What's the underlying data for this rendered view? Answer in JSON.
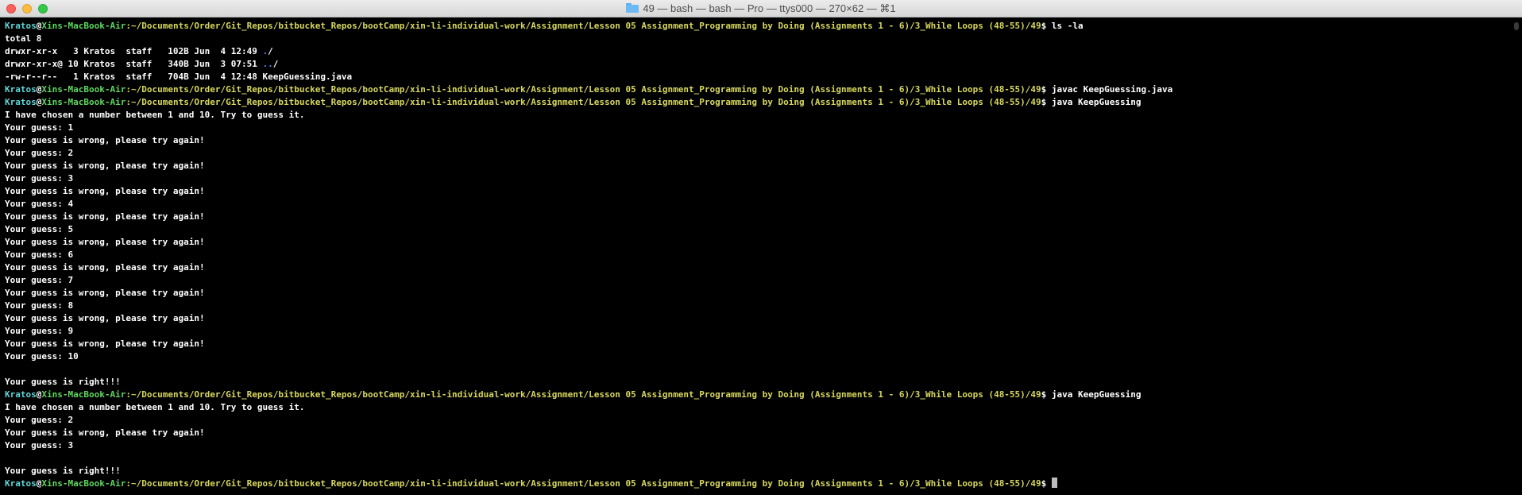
{
  "window": {
    "title": "49 — bash — bash — Pro — ttys000 — 270×62 — ⌘1",
    "folder_icon": "folder-icon"
  },
  "prompt": {
    "user": "Kratos",
    "at": "@",
    "host": "Xins-MacBook-Air",
    "path": ":~/Documents/Order/Git_Repos/bitbucket_Repos/bootCamp/xin-li-individual-work/Assignment/Lesson 05 Assignment_Programming by Doing (Assignments 1 - 6)/3_While Loops (48-55)/49",
    "dollar": "$ "
  },
  "colors": {
    "background": "#000000",
    "user": "#5fd7d7",
    "host": "#5fd75f",
    "path": "#d7d75f",
    "directory": "#5f87ff",
    "text": "#ffffff"
  },
  "lines": [
    {
      "type": "prompt",
      "cmd": "ls -la"
    },
    {
      "type": "out",
      "text": "total 8"
    },
    {
      "type": "ls",
      "pre": "drwxr-xr-x   3 Kratos  staff   102B Jun  4 12:49 ",
      "dir": ".",
      "post": "/"
    },
    {
      "type": "ls",
      "pre": "drwxr-xr-x@ 10 Kratos  staff   340B Jun  3 07:51 ",
      "dir": "..",
      "post": "/"
    },
    {
      "type": "out",
      "text": "-rw-r--r--   1 Kratos  staff   704B Jun  4 12:48 KeepGuessing.java"
    },
    {
      "type": "prompt",
      "cmd": "javac KeepGuessing.java"
    },
    {
      "type": "prompt",
      "cmd": "java KeepGuessing"
    },
    {
      "type": "out",
      "text": "I have chosen a number between 1 and 10. Try to guess it."
    },
    {
      "type": "out",
      "text": "Your guess: 1"
    },
    {
      "type": "out",
      "text": "Your guess is wrong, please try again!"
    },
    {
      "type": "out",
      "text": "Your guess: 2"
    },
    {
      "type": "out",
      "text": "Your guess is wrong, please try again!"
    },
    {
      "type": "out",
      "text": "Your guess: 3"
    },
    {
      "type": "out",
      "text": "Your guess is wrong, please try again!"
    },
    {
      "type": "out",
      "text": "Your guess: 4"
    },
    {
      "type": "out",
      "text": "Your guess is wrong, please try again!"
    },
    {
      "type": "out",
      "text": "Your guess: 5"
    },
    {
      "type": "out",
      "text": "Your guess is wrong, please try again!"
    },
    {
      "type": "out",
      "text": "Your guess: 6"
    },
    {
      "type": "out",
      "text": "Your guess is wrong, please try again!"
    },
    {
      "type": "out",
      "text": "Your guess: 7"
    },
    {
      "type": "out",
      "text": "Your guess is wrong, please try again!"
    },
    {
      "type": "out",
      "text": "Your guess: 8"
    },
    {
      "type": "out",
      "text": "Your guess is wrong, please try again!"
    },
    {
      "type": "out",
      "text": "Your guess: 9"
    },
    {
      "type": "out",
      "text": "Your guess is wrong, please try again!"
    },
    {
      "type": "out",
      "text": "Your guess: 10"
    },
    {
      "type": "out",
      "text": ""
    },
    {
      "type": "out",
      "text": "Your guess is right!!!"
    },
    {
      "type": "prompt",
      "cmd": "java KeepGuessing"
    },
    {
      "type": "out",
      "text": "I have chosen a number between 1 and 10. Try to guess it."
    },
    {
      "type": "out",
      "text": "Your guess: 2"
    },
    {
      "type": "out",
      "text": "Your guess is wrong, please try again!"
    },
    {
      "type": "out",
      "text": "Your guess: 3"
    },
    {
      "type": "out",
      "text": ""
    },
    {
      "type": "out",
      "text": "Your guess is right!!!"
    },
    {
      "type": "prompt",
      "cmd": "",
      "cursor": true
    }
  ]
}
